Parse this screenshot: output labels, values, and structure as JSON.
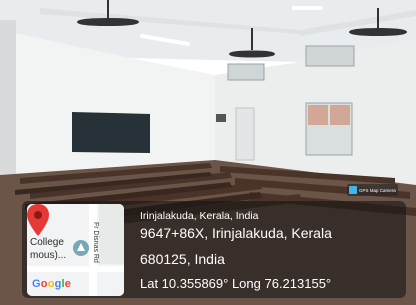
{
  "photo": {
    "description_icon": "classroom-photo"
  },
  "gps_badge": {
    "label": "GPS Map Camera",
    "icon": "gps-camera-icon"
  },
  "map": {
    "place_label": "College\nmous)...",
    "road_label": "Fr Disnas Rd",
    "logo_text": "Google",
    "pin_icon": "map-pin-icon"
  },
  "location": {
    "line1": "Irinjalakuda, Kerala, India",
    "line2": "9647+86X, Irinjalakuda, Kerala",
    "line3": "680125, India",
    "line4": "Lat 10.355869° Long 76.213155°"
  },
  "colors": {
    "overlay": "#141414",
    "pin": "#e53935",
    "google_blue": "#4285F4",
    "google_red": "#EA4335",
    "google_yellow": "#FBBC05",
    "google_green": "#34A853"
  }
}
